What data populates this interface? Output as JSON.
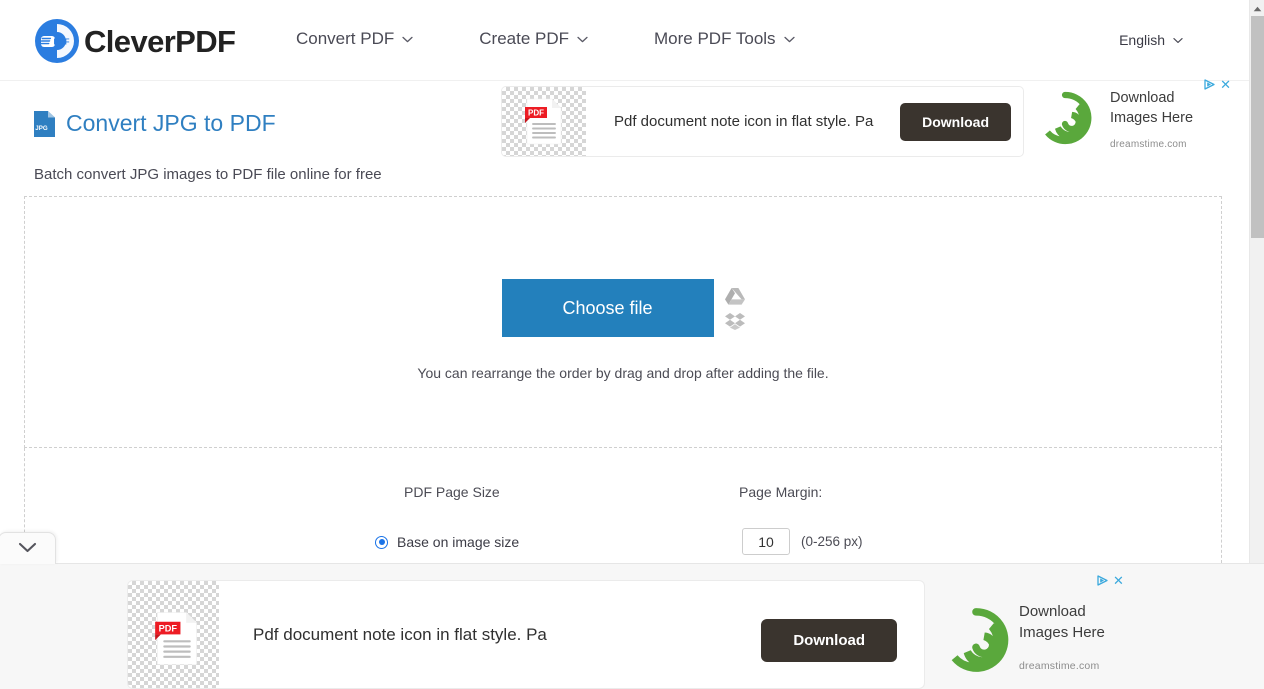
{
  "site": {
    "logo_text": "CleverPDF",
    "logo_badge": "PDF"
  },
  "nav": {
    "items": [
      {
        "label": "Convert PDF",
        "icon": "chevron-down-icon"
      },
      {
        "label": "Create PDF",
        "icon": "chevron-down-icon"
      },
      {
        "label": "More PDF Tools",
        "icon": "chevron-down-icon"
      }
    ],
    "language": {
      "label": "English",
      "icon": "chevron-down-icon"
    }
  },
  "tool": {
    "icon_label": "JPG",
    "title": "Convert JPG to PDF",
    "subtitle": "Batch convert JPG images to PDF file online for free"
  },
  "upload": {
    "choose_file_label": "Choose file",
    "hint": "You can rearrange the order by drag and drop after adding the file.",
    "cloud_sources": [
      {
        "name": "google-drive-icon"
      },
      {
        "name": "dropbox-icon"
      }
    ]
  },
  "options": {
    "page_size_label": "PDF Page Size",
    "page_margin_label": "Page Margin:",
    "page_size_choice": "Base on image size",
    "page_size_selected": true,
    "margin_value": "10",
    "margin_hint": "(0-256 px)"
  },
  "ads": {
    "top": {
      "thumb_label": "PDF",
      "text": "Pdf document note icon in flat style. Pa",
      "download_label": "Download",
      "sponsor_line1": "Download",
      "sponsor_line2": "Images Here",
      "sponsor_domain": "dreamstime.com",
      "close_label": "✕"
    },
    "bottom": {
      "thumb_label": "PDF",
      "text": "Pdf document note icon in flat style. Pa",
      "download_label": "Download",
      "sponsor_line1": "Download",
      "sponsor_line2": "Images Here",
      "sponsor_domain": "dreamstime.com",
      "close_label": "✕"
    }
  },
  "colors": {
    "primary_blue": "#2380bc",
    "title_blue": "#2f7fc1",
    "radio_blue": "#1a73e8",
    "ad_button_dark": "#3a342e",
    "sponsor_green": "#5aa83c",
    "adchoices_cyan": "#3ba9dd",
    "pdf_red": "#ed1c24"
  }
}
